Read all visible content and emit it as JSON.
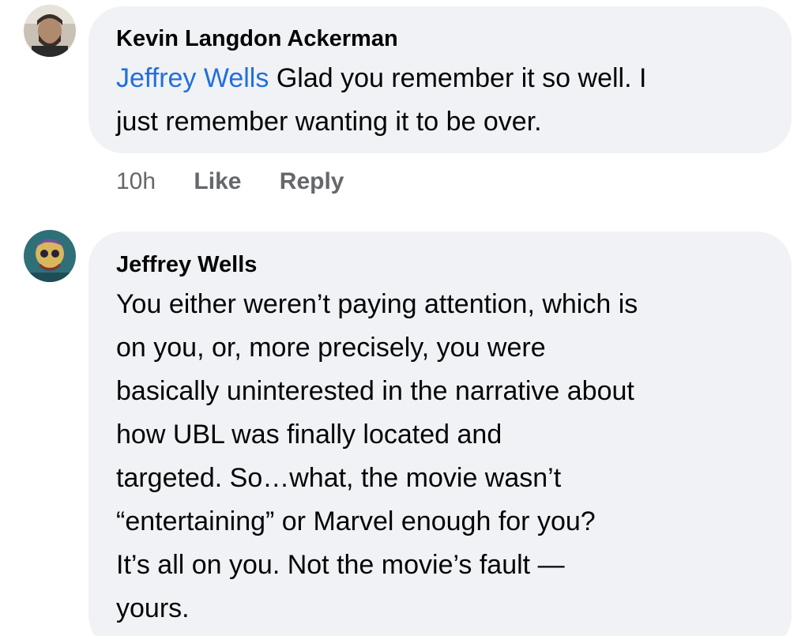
{
  "comments": [
    {
      "author": "Kevin Langdon Ackerman",
      "avatar_icon": "user-avatar-icon",
      "mention": "Jeffrey Wells",
      "text_line1": "Glad you remember it so well. I",
      "text_line2": "just remember wanting it to be over.",
      "time": "10h",
      "like_label": "Like",
      "reply_label": "Reply"
    },
    {
      "author": "Jeffrey Wells",
      "avatar_icon": "user-avatar-icon",
      "lines": [
        "You either weren’t paying attention, which is",
        "on you, or, more precisely, you were",
        "basically uninterested in the narrative about",
        "how UBL was finally located and",
        "targeted.  So…what, the movie wasn’t",
        "“entertaining” or Marvel enough for you?",
        "It’s all on you.  Not the movie’s fault —",
        "yours."
      ]
    }
  ],
  "colors": {
    "bubble": "#f0f2f5",
    "mention": "#216fdb",
    "meta": "#65676b"
  }
}
